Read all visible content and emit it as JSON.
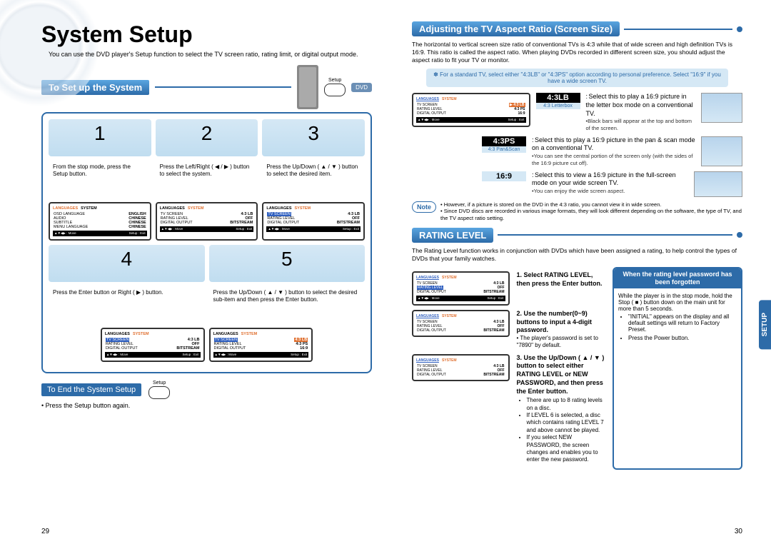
{
  "left": {
    "title": "System Setup",
    "intro": "You can use the DVD player's Setup function to select the TV screen ratio, rating limit, or digital output mode.",
    "setup_header": "To Set up the System",
    "setup_label": "Setup",
    "dvd_label": "DVD",
    "steps": [
      {
        "n": "1",
        "text": "From the stop mode, press the Setup button."
      },
      {
        "n": "2",
        "text": "Press the Left/Right ( ◀ / ▶ ) button to select the system."
      },
      {
        "n": "3",
        "text": "Press the Up/Down ( ▲ / ▼ ) button to select the desired item."
      },
      {
        "n": "4",
        "text": "Press the Enter button or Right ( ▶ ) button."
      },
      {
        "n": "5",
        "text": "Press the Up/Down ( ▲ / ▼ ) button to select the desired sub-item and then press the Enter button."
      }
    ],
    "osd": {
      "tabs": {
        "lang": "LANGUAGES",
        "sys": "SYSTEM"
      },
      "lang_rows": [
        [
          "OSD LANGUAGE",
          "ENGLISH"
        ],
        [
          "AUDIO",
          "CHINESE"
        ],
        [
          "SUBTITLE",
          "CHINESE"
        ],
        [
          "MENU LANGUAGE",
          "CHINESE"
        ]
      ],
      "sys_rows": [
        [
          "TV SCREEN",
          "4:3 LB"
        ],
        [
          "RATING LEVEL",
          "OFF"
        ],
        [
          "DIGITAL OUTPUT",
          "BITSTREAM"
        ]
      ],
      "sys_rows5": [
        [
          "TV SCREEN",
          ""
        ],
        [
          "RATING LEVEL",
          "4:3 PS"
        ],
        [
          "DIGITAL OUTPUT",
          "16:9"
        ]
      ],
      "hl43": "4:3 LB",
      "foot_l": "▲▼◀▶ : Move",
      "foot_r": "Setup : Exit"
    },
    "end_title": "To End the System Setup",
    "end_note": "• Press the Setup button again.",
    "page_num": "29"
  },
  "right": {
    "aspect": {
      "title": "Adjusting the TV Aspect Ratio (Screen Size)",
      "intro": "The horizontal to vertical screen size ratio of conventional TVs is 4:3 while that of wide screen and high definition TVs is 16:9. This ratio is called the aspect ratio. When playing DVDs recorded in different screen size, you should adjust the aspect ratio to fit your TV or monitor.",
      "tip": "✽ For a standard TV, select either \"4:3LB\" or \"4:3PS\" option according to personal preference. Select \"16:9\" if you have a wide screen TV.",
      "modes": [
        {
          "main": "4:3LB",
          "sub": "4:3 Letterbox",
          "text": "Select this to play a 16:9 picture in the letter box mode on a conventional TV.",
          "note": "•Black bars will appear at the top and bottom of the screen."
        },
        {
          "main": "4:3PS",
          "sub": "4:3 Pan&Scan",
          "text": "Select this to play a 16:9 picture in the pan & scan mode on a conventional TV.",
          "note": "•You can see the central portion of the screen only (with the sides of the 16:9 picture cut off)."
        },
        {
          "main": "16:9",
          "sub": "",
          "text": "Select this to view a 16:9 picture in the full-screen mode on your wide screen TV.",
          "note": "•You can enjoy the wide screen aspect."
        }
      ],
      "osd_rows": [
        [
          "TV SCREEN",
          "▶ 4:3 LB"
        ],
        [
          "RATING LEVEL",
          "4:3 PS"
        ],
        [
          "DIGITAL OUTPUT",
          "16:9"
        ]
      ],
      "note_label": "Note",
      "note_text": "• However, if a picture is stored on the DVD in the 4:3 ratio, you cannot view it in wide screen.\n• Since DVD discs are recorded in various image formats, they will look different depending on the software, the type of TV, and the TV aspect ratio setting."
    },
    "rating": {
      "title": "RATING LEVEL",
      "intro": "The Rating Level function works in conjunction with DVDs which have been assigned a rating, to help control the types of DVDs that your family watches.",
      "step1": "1. Select RATING LEVEL, then press the Enter button.",
      "step2": "2. Use the number(0~9) buttons to input a 4-digit password.",
      "step2_note": "• The player's password is set to \"7890\" by default.",
      "step3": "3. Use the Up/Down ( ▲ / ▼ ) button to select either RATING LEVEL or NEW PASSWORD, and then press the Enter button.",
      "step3_notes": [
        "There are up to 8 rating levels on a disc.",
        "If LEVEL 6 is selected, a disc which contains rating LEVEL 7 and above cannot be played.",
        "If you select NEW PASSWORD, the screen changes and enables you to enter the new password."
      ],
      "osd1": [
        [
          "TV SCREEN",
          "4:3 LB"
        ],
        [
          "RATING LEVEL",
          "OFF"
        ],
        [
          "DIGITAL OUTPUT",
          "BITSTREAM"
        ]
      ],
      "forgot": {
        "head": "When the rating level password has been forgotten",
        "body1": "While the player is in the stop mode, hold the Stop ( ■ ) button down on the main unit for more than 5 seconds.",
        "li1": "\"INITIAL\" appears on the display and all default settings will return to Factory Preset.",
        "li2": "Press the Power button."
      }
    },
    "side_tab": "SETUP",
    "page_num": "30"
  }
}
